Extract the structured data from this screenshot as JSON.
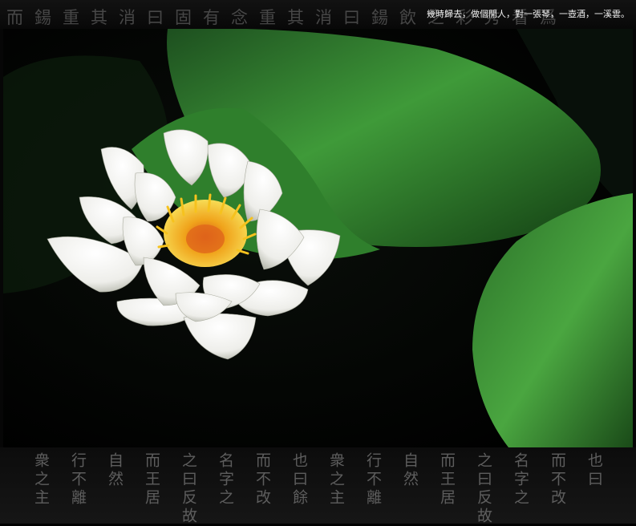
{
  "caption": "幾時歸去，做個閒人，對一張琴，一壺酒，一溪雲。",
  "calligraphy_top": "而鍚重其消曰固有念重其消曰鍚飲之彩秀看爲",
  "calligraphy_bottom_columns": [
    "衆之主",
    "行不離",
    "自然",
    "而王居",
    "之曰反故",
    "名字之",
    "而不改",
    "也曰餘",
    "衆之主",
    "行不離",
    "自然",
    "而王居",
    "之曰反故",
    "名字之",
    "而不改",
    "也曰"
  ],
  "colors": {
    "background": "#000000",
    "leaf": "#2e7d2a",
    "petal": "#f4f4ef",
    "stamen": "#f2b21a"
  },
  "scene": "white water lily with yellow center and green lily pads on black water"
}
